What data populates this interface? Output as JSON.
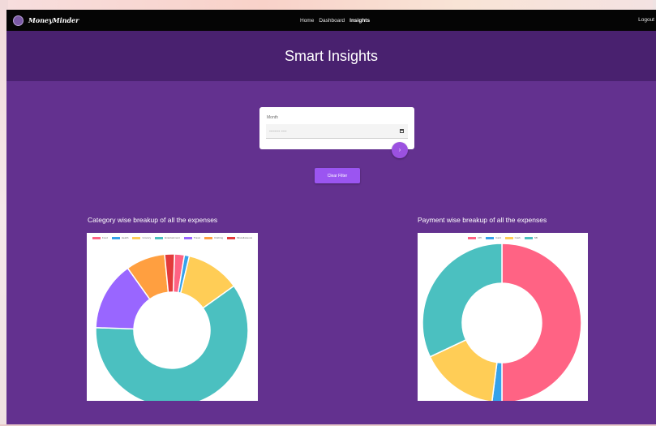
{
  "navbar": {
    "brand": "MoneyMinder",
    "links": [
      {
        "label": "Home"
      },
      {
        "label": "Dashboard"
      },
      {
        "label": "Insights"
      }
    ],
    "logout": "Logout"
  },
  "header": {
    "title": "Smart Insights"
  },
  "date_filter": {
    "label": "Month",
    "value": "",
    "placeholder": "-------- ----",
    "fab_icon": "chevron-right-icon",
    "clear_label": "Clear Filter"
  },
  "chart_data": [
    {
      "type": "pie",
      "title": "Category wise breakup of all the expenses",
      "legend_position": "top",
      "series": [
        {
          "name": "Food",
          "value": 2,
          "color": "#ff6384"
        },
        {
          "name": "Health",
          "value": 1,
          "color": "#36a2eb"
        },
        {
          "name": "Grocery",
          "value": 11,
          "color": "#ffcd56"
        },
        {
          "name": "Entertainment",
          "value": 58,
          "color": "#4bc0c0"
        },
        {
          "name": "Travel",
          "value": 14,
          "color": "#9966ff"
        },
        {
          "name": "Clothing",
          "value": 8,
          "color": "#ff9f40"
        },
        {
          "name": "Miscellaneous",
          "value": 2,
          "color": "#e23b3b"
        }
      ]
    },
    {
      "type": "pie",
      "title": "Payment wise breakup of all the expenses",
      "legend_position": "top",
      "series": [
        {
          "name": "UPI",
          "value": 50,
          "color": "#ff6384"
        },
        {
          "name": "Card",
          "value": 2,
          "color": "#36a2eb"
        },
        {
          "name": "Cash",
          "value": 16,
          "color": "#ffcd56"
        },
        {
          "name": "NB",
          "value": 32,
          "color": "#4bc0c0"
        }
      ]
    }
  ]
}
